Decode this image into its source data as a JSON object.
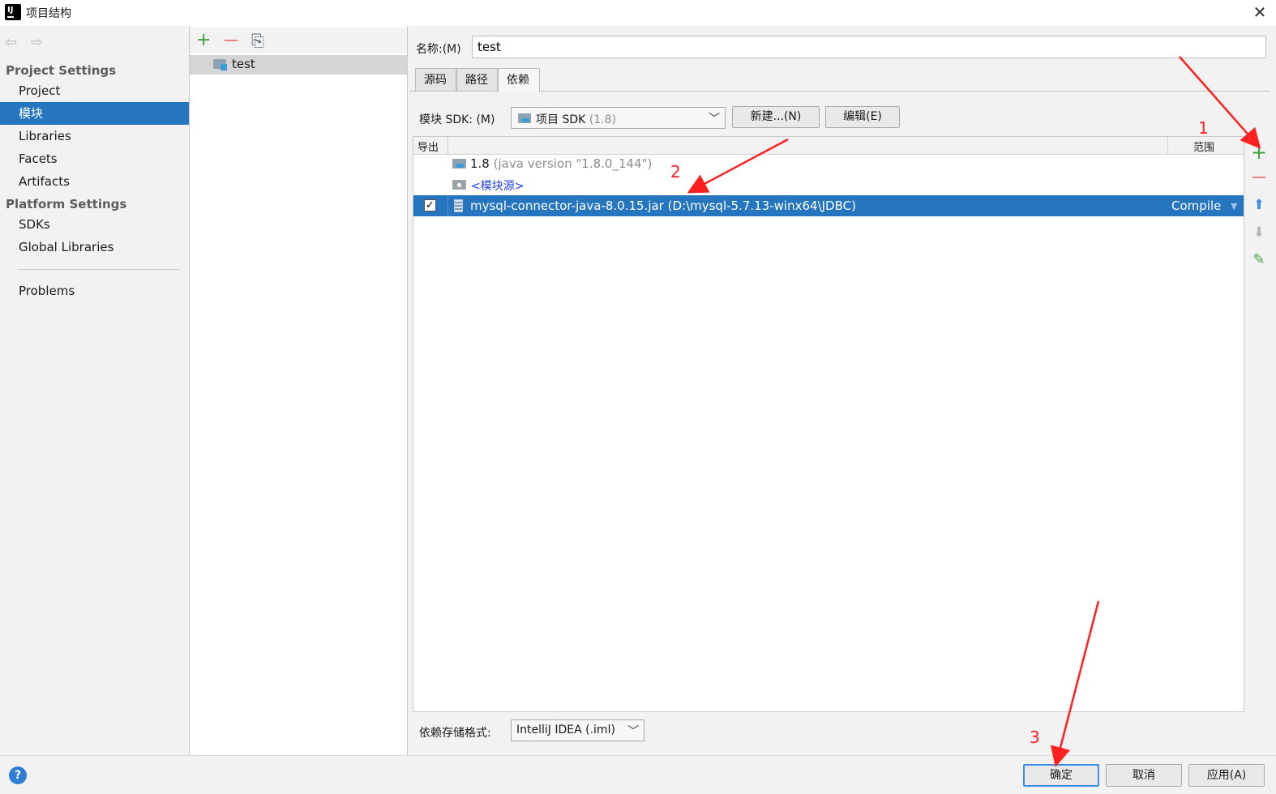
{
  "window": {
    "title": "项目结构",
    "close": "✕"
  },
  "nav": {
    "back": "⇦",
    "forward": "⇨"
  },
  "sidebar": {
    "project_settings_title": "Project Settings",
    "items": [
      {
        "label": "Project"
      },
      {
        "label": "模块"
      },
      {
        "label": "Libraries"
      },
      {
        "label": "Facets"
      },
      {
        "label": "Artifacts"
      }
    ],
    "platform_settings_title": "Platform Settings",
    "platform_items": [
      {
        "label": "SDKs"
      },
      {
        "label": "Global Libraries"
      }
    ],
    "problems": "Problems"
  },
  "modules": {
    "toolbar": {
      "add": "+",
      "remove": "—",
      "copy": "⎘"
    },
    "list": [
      {
        "name": "test"
      }
    ]
  },
  "module_detail": {
    "name_label": "名称:(M)",
    "name_value": "test",
    "tabs": [
      {
        "label": "源码"
      },
      {
        "label": "路径"
      },
      {
        "label": "依赖"
      }
    ],
    "sdk": {
      "label": "模块 SDK:  (M)",
      "selected": "项目 SDK",
      "selected_sub": "(1.8)",
      "new_button": "新建...(N)",
      "edit_button": "编辑(E)"
    },
    "dependencies": {
      "col_export": "导出",
      "col_scope": "范围",
      "rows": [
        {
          "name": "1.8",
          "detail": "(java version \"1.8.0_144\")"
        },
        {
          "name": "<模块源>"
        },
        {
          "name": "mysql-connector-java-8.0.15.jar (D:\\mysql-5.7.13-winx64\\JDBC)",
          "scope": "Compile",
          "checked": "✓"
        }
      ]
    },
    "side_tools": {
      "add": "+",
      "remove": "—",
      "up": "⬆",
      "down": "⬇",
      "edit": "✎"
    },
    "storage": {
      "label": "依赖存储格式:",
      "value": "IntelliJ IDEA (.iml)"
    }
  },
  "footer": {
    "help": "?",
    "ok": "确定",
    "cancel": "取消",
    "apply": "应用(A)"
  },
  "annotations": {
    "step1": "1",
    "step2": "2",
    "step3": "3"
  },
  "colors": {
    "selection": "#2675bf",
    "annotation": "#ff2020",
    "add_green": "#3aa33a",
    "remove_red": "#e04343"
  }
}
